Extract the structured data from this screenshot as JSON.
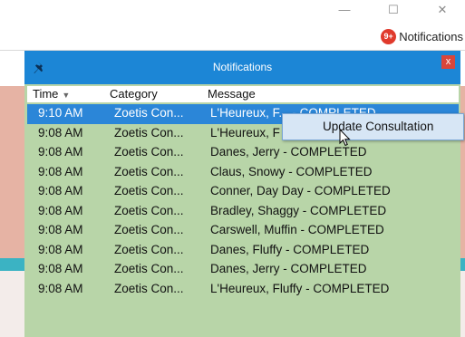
{
  "window": {
    "controls": [
      "—",
      "☐",
      "✕"
    ]
  },
  "toolbar": {
    "badge": "9+",
    "notifications_label": "Notifications"
  },
  "popup": {
    "title": "Notifications",
    "close_label": "x",
    "columns": {
      "time": "Time",
      "category": "Category",
      "message": "Message"
    },
    "rows": [
      {
        "time": "9:10 AM",
        "category": "Zoetis Con...",
        "message": "L'Heureux, F... - COMPLETED",
        "selected": true
      },
      {
        "time": "9:08 AM",
        "category": "Zoetis Con...",
        "message": "L'Heureux, F"
      },
      {
        "time": "9:08 AM",
        "category": "Zoetis Con...",
        "message": "Danes, Jerry - COMPLETED"
      },
      {
        "time": "9:08 AM",
        "category": "Zoetis Con...",
        "message": "Claus, Snowy - COMPLETED"
      },
      {
        "time": "9:08 AM",
        "category": "Zoetis Con...",
        "message": "Conner, Day Day - COMPLETED"
      },
      {
        "time": "9:08 AM",
        "category": "Zoetis Con...",
        "message": "Bradley, Shaggy - COMPLETED"
      },
      {
        "time": "9:08 AM",
        "category": "Zoetis Con...",
        "message": "Carswell, Muffin - COMPLETED"
      },
      {
        "time": "9:08 AM",
        "category": "Zoetis Con...",
        "message": "Danes, Fluffy - COMPLETED"
      },
      {
        "time": "9:08 AM",
        "category": "Zoetis Con...",
        "message": "Danes, Jerry - COMPLETED"
      },
      {
        "time": "9:08 AM",
        "category": "Zoetis Con...",
        "message": "L'Heureux, Fluffy - COMPLETED"
      }
    ]
  },
  "context_menu": {
    "items": [
      "Update Consultation"
    ]
  },
  "colors": {
    "header_blue": "#1c86d6",
    "popup_green": "#b8d5a8",
    "selection": "#2b86d8",
    "badge_red": "#e03a2c"
  }
}
